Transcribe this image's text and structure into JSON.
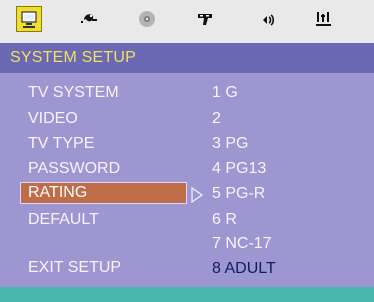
{
  "top_icons": [
    {
      "name": "system-setup-icon",
      "active": true
    },
    {
      "name": "language-icon",
      "active": false
    },
    {
      "name": "disc-icon",
      "active": false
    },
    {
      "name": "video-setup-icon",
      "active": false
    },
    {
      "name": "audio-setup-icon",
      "active": false
    },
    {
      "name": "preferences-icon",
      "active": false
    }
  ],
  "header": {
    "title": "SYSTEM SETUP"
  },
  "menu": {
    "left_items": [
      {
        "label": "TV SYSTEM",
        "selected": false
      },
      {
        "label": "VIDEO",
        "selected": false
      },
      {
        "label": "TV TYPE",
        "selected": false
      },
      {
        "label": "PASSWORD",
        "selected": false
      },
      {
        "label": "RATING",
        "selected": true
      },
      {
        "label": "DEFAULT",
        "selected": false
      },
      {
        "label": "EXIT SETUP",
        "selected": false
      }
    ],
    "right_items": [
      {
        "label": "1 G",
        "selected": false
      },
      {
        "label": "2",
        "selected": false
      },
      {
        "label": "3 PG",
        "selected": false
      },
      {
        "label": "4 PG13",
        "selected": false
      },
      {
        "label": "5 PG-R",
        "selected": false
      },
      {
        "label": "6 R",
        "selected": false
      },
      {
        "label": "7 NC-17",
        "selected": false
      },
      {
        "label": "8 ADULT",
        "selected": true
      }
    ]
  },
  "colors": {
    "header_bg": "#6b69b3",
    "header_text": "#f1e15c",
    "menu_bg": "#9d96d1",
    "selected_bg": "#bf6d49",
    "selected_right_text": "#121d5f",
    "bottom_bar": "#49b7ad"
  }
}
